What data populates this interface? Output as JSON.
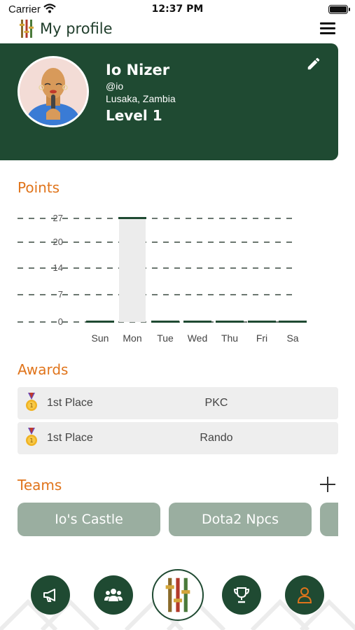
{
  "status_bar": {
    "carrier": "Carrier",
    "time": "12:37 PM"
  },
  "header": {
    "title": "My profile",
    "logo_icon": "app-logo-sliders",
    "menu_icon": "hamburger-menu-icon"
  },
  "profile": {
    "name": "Io Nizer",
    "handle": "@io",
    "location": "Lusaka, Zambia",
    "level": "Level 1",
    "edit_icon": "pencil-icon"
  },
  "points": {
    "title": "Points"
  },
  "chart_data": {
    "type": "bar",
    "title": "Points",
    "categories": [
      "Sun",
      "Mon",
      "Tue",
      "Wed",
      "Thu",
      "Fri",
      "Sa"
    ],
    "values": [
      0,
      27,
      0,
      0,
      0,
      0,
      0
    ],
    "yticks": [
      "27",
      "20",
      "14",
      "7",
      "0"
    ],
    "ylim": [
      0,
      27
    ],
    "grid": true,
    "grid_style": "dashed",
    "xlabel": "",
    "ylabel": ""
  },
  "awards": {
    "title": "Awards",
    "items": [
      {
        "place": "1st Place",
        "event": "PKC"
      },
      {
        "place": "1st Place",
        "event": "Rando"
      }
    ]
  },
  "teams": {
    "title": "Teams",
    "items": [
      {
        "name": "Io's Castle"
      },
      {
        "name": "Dota2 Npcs"
      },
      {
        "name": ""
      }
    ]
  },
  "nav": {
    "items": [
      "megaphone-icon",
      "group-icon",
      "app-logo-sliders",
      "trophy-icon",
      "user-icon"
    ]
  },
  "colors": {
    "primary": "#1f4a32",
    "accent": "#e0741b",
    "team_pill": "#9aaea0",
    "award_bg": "#eeeeee"
  }
}
